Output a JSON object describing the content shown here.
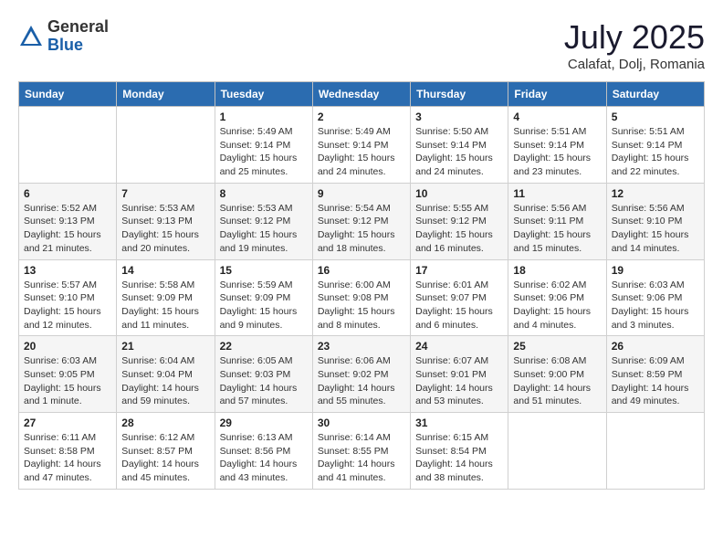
{
  "logo": {
    "general": "General",
    "blue": "Blue"
  },
  "title": {
    "month_year": "July 2025",
    "location": "Calafat, Dolj, Romania"
  },
  "days_of_week": [
    "Sunday",
    "Monday",
    "Tuesday",
    "Wednesday",
    "Thursday",
    "Friday",
    "Saturday"
  ],
  "weeks": [
    [
      {
        "day": "",
        "detail": ""
      },
      {
        "day": "",
        "detail": ""
      },
      {
        "day": "1",
        "detail": "Sunrise: 5:49 AM\nSunset: 9:14 PM\nDaylight: 15 hours\nand 25 minutes."
      },
      {
        "day": "2",
        "detail": "Sunrise: 5:49 AM\nSunset: 9:14 PM\nDaylight: 15 hours\nand 24 minutes."
      },
      {
        "day": "3",
        "detail": "Sunrise: 5:50 AM\nSunset: 9:14 PM\nDaylight: 15 hours\nand 24 minutes."
      },
      {
        "day": "4",
        "detail": "Sunrise: 5:51 AM\nSunset: 9:14 PM\nDaylight: 15 hours\nand 23 minutes."
      },
      {
        "day": "5",
        "detail": "Sunrise: 5:51 AM\nSunset: 9:14 PM\nDaylight: 15 hours\nand 22 minutes."
      }
    ],
    [
      {
        "day": "6",
        "detail": "Sunrise: 5:52 AM\nSunset: 9:13 PM\nDaylight: 15 hours\nand 21 minutes."
      },
      {
        "day": "7",
        "detail": "Sunrise: 5:53 AM\nSunset: 9:13 PM\nDaylight: 15 hours\nand 20 minutes."
      },
      {
        "day": "8",
        "detail": "Sunrise: 5:53 AM\nSunset: 9:12 PM\nDaylight: 15 hours\nand 19 minutes."
      },
      {
        "day": "9",
        "detail": "Sunrise: 5:54 AM\nSunset: 9:12 PM\nDaylight: 15 hours\nand 18 minutes."
      },
      {
        "day": "10",
        "detail": "Sunrise: 5:55 AM\nSunset: 9:12 PM\nDaylight: 15 hours\nand 16 minutes."
      },
      {
        "day": "11",
        "detail": "Sunrise: 5:56 AM\nSunset: 9:11 PM\nDaylight: 15 hours\nand 15 minutes."
      },
      {
        "day": "12",
        "detail": "Sunrise: 5:56 AM\nSunset: 9:10 PM\nDaylight: 15 hours\nand 14 minutes."
      }
    ],
    [
      {
        "day": "13",
        "detail": "Sunrise: 5:57 AM\nSunset: 9:10 PM\nDaylight: 15 hours\nand 12 minutes."
      },
      {
        "day": "14",
        "detail": "Sunrise: 5:58 AM\nSunset: 9:09 PM\nDaylight: 15 hours\nand 11 minutes."
      },
      {
        "day": "15",
        "detail": "Sunrise: 5:59 AM\nSunset: 9:09 PM\nDaylight: 15 hours\nand 9 minutes."
      },
      {
        "day": "16",
        "detail": "Sunrise: 6:00 AM\nSunset: 9:08 PM\nDaylight: 15 hours\nand 8 minutes."
      },
      {
        "day": "17",
        "detail": "Sunrise: 6:01 AM\nSunset: 9:07 PM\nDaylight: 15 hours\nand 6 minutes."
      },
      {
        "day": "18",
        "detail": "Sunrise: 6:02 AM\nSunset: 9:06 PM\nDaylight: 15 hours\nand 4 minutes."
      },
      {
        "day": "19",
        "detail": "Sunrise: 6:03 AM\nSunset: 9:06 PM\nDaylight: 15 hours\nand 3 minutes."
      }
    ],
    [
      {
        "day": "20",
        "detail": "Sunrise: 6:03 AM\nSunset: 9:05 PM\nDaylight: 15 hours\nand 1 minute."
      },
      {
        "day": "21",
        "detail": "Sunrise: 6:04 AM\nSunset: 9:04 PM\nDaylight: 14 hours\nand 59 minutes."
      },
      {
        "day": "22",
        "detail": "Sunrise: 6:05 AM\nSunset: 9:03 PM\nDaylight: 14 hours\nand 57 minutes."
      },
      {
        "day": "23",
        "detail": "Sunrise: 6:06 AM\nSunset: 9:02 PM\nDaylight: 14 hours\nand 55 minutes."
      },
      {
        "day": "24",
        "detail": "Sunrise: 6:07 AM\nSunset: 9:01 PM\nDaylight: 14 hours\nand 53 minutes."
      },
      {
        "day": "25",
        "detail": "Sunrise: 6:08 AM\nSunset: 9:00 PM\nDaylight: 14 hours\nand 51 minutes."
      },
      {
        "day": "26",
        "detail": "Sunrise: 6:09 AM\nSunset: 8:59 PM\nDaylight: 14 hours\nand 49 minutes."
      }
    ],
    [
      {
        "day": "27",
        "detail": "Sunrise: 6:11 AM\nSunset: 8:58 PM\nDaylight: 14 hours\nand 47 minutes."
      },
      {
        "day": "28",
        "detail": "Sunrise: 6:12 AM\nSunset: 8:57 PM\nDaylight: 14 hours\nand 45 minutes."
      },
      {
        "day": "29",
        "detail": "Sunrise: 6:13 AM\nSunset: 8:56 PM\nDaylight: 14 hours\nand 43 minutes."
      },
      {
        "day": "30",
        "detail": "Sunrise: 6:14 AM\nSunset: 8:55 PM\nDaylight: 14 hours\nand 41 minutes."
      },
      {
        "day": "31",
        "detail": "Sunrise: 6:15 AM\nSunset: 8:54 PM\nDaylight: 14 hours\nand 38 minutes."
      },
      {
        "day": "",
        "detail": ""
      },
      {
        "day": "",
        "detail": ""
      }
    ]
  ]
}
